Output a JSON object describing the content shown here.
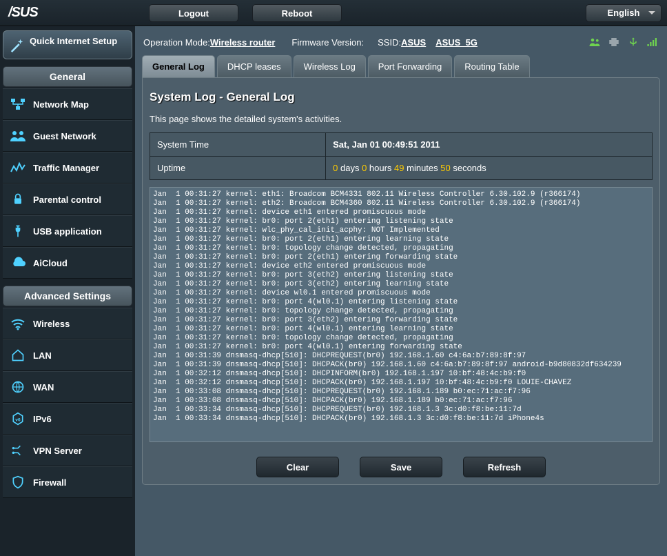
{
  "topbar": {
    "logo_text": "/SUS",
    "logout": "Logout",
    "reboot": "Reboot",
    "language": "English"
  },
  "qis": {
    "label": "Quick Internet Setup"
  },
  "sidebar": {
    "general_header": "General",
    "advanced_header": "Advanced Settings",
    "general": [
      {
        "label": "Network Map"
      },
      {
        "label": "Guest Network"
      },
      {
        "label": "Traffic Manager"
      },
      {
        "label": "Parental control"
      },
      {
        "label": "USB application"
      },
      {
        "label": "AiCloud"
      }
    ],
    "advanced": [
      {
        "label": "Wireless"
      },
      {
        "label": "LAN"
      },
      {
        "label": "WAN"
      },
      {
        "label": "IPv6"
      },
      {
        "label": "VPN Server"
      },
      {
        "label": "Firewall"
      }
    ]
  },
  "status": {
    "opmode_label": "Operation Mode: ",
    "opmode": "Wireless router",
    "fw_label": "Firmware Version:",
    "ssid_label": "SSID: ",
    "ssid1": "ASUS",
    "ssid2": "ASUS_5G"
  },
  "tabs": [
    {
      "label": "General Log",
      "active": true
    },
    {
      "label": "DHCP leases",
      "active": false
    },
    {
      "label": "Wireless Log",
      "active": false
    },
    {
      "label": "Port Forwarding",
      "active": false
    },
    {
      "label": "Routing Table",
      "active": false
    }
  ],
  "panel": {
    "title": "System Log - General Log",
    "desc": "This page shows the detailed system's activities.",
    "systime_label": "System Time",
    "systime_value": "Sat, Jan 01  00:49:51  2011",
    "uptime_label": "Uptime",
    "uptime_days": "0",
    "uptime_days_unit": " days ",
    "uptime_hours": "0",
    "uptime_hours_unit": " hours ",
    "uptime_min": "49",
    "uptime_min_unit": " minutes ",
    "uptime_sec": "50",
    "uptime_sec_unit": " seconds",
    "log": "Jan  1 00:31:27 kernel: eth1: Broadcom BCM4331 802.11 Wireless Controller 6.30.102.9 (r366174)\nJan  1 00:31:27 kernel: eth2: Broadcom BCM4360 802.11 Wireless Controller 6.30.102.9 (r366174)\nJan  1 00:31:27 kernel: device eth1 entered promiscuous mode\nJan  1 00:31:27 kernel: br0: port 2(eth1) entering listening state\nJan  1 00:31:27 kernel: wlc_phy_cal_init_acphy: NOT Implemented\nJan  1 00:31:27 kernel: br0: port 2(eth1) entering learning state\nJan  1 00:31:27 kernel: br0: topology change detected, propagating\nJan  1 00:31:27 kernel: br0: port 2(eth1) entering forwarding state\nJan  1 00:31:27 kernel: device eth2 entered promiscuous mode\nJan  1 00:31:27 kernel: br0: port 3(eth2) entering listening state\nJan  1 00:31:27 kernel: br0: port 3(eth2) entering learning state\nJan  1 00:31:27 kernel: device wl0.1 entered promiscuous mode\nJan  1 00:31:27 kernel: br0: port 4(wl0.1) entering listening state\nJan  1 00:31:27 kernel: br0: topology change detected, propagating\nJan  1 00:31:27 kernel: br0: port 3(eth2) entering forwarding state\nJan  1 00:31:27 kernel: br0: port 4(wl0.1) entering learning state\nJan  1 00:31:27 kernel: br0: topology change detected, propagating\nJan  1 00:31:27 kernel: br0: port 4(wl0.1) entering forwarding state\nJan  1 00:31:39 dnsmasq-dhcp[510]: DHCPREQUEST(br0) 192.168.1.60 c4:6a:b7:89:8f:97\nJan  1 00:31:39 dnsmasq-dhcp[510]: DHCPACK(br0) 192.168.1.60 c4:6a:b7:89:8f:97 android-b9d80832df634239\nJan  1 00:32:12 dnsmasq-dhcp[510]: DHCPINFORM(br0) 192.168.1.197 10:bf:48:4c:b9:f0\nJan  1 00:32:12 dnsmasq-dhcp[510]: DHCPACK(br0) 192.168.1.197 10:bf:48:4c:b9:f0 LOUIE-CHAVEZ\nJan  1 00:33:08 dnsmasq-dhcp[510]: DHCPREQUEST(br0) 192.168.1.189 b0:ec:71:ac:f7:96\nJan  1 00:33:08 dnsmasq-dhcp[510]: DHCPACK(br0) 192.168.1.189 b0:ec:71:ac:f7:96\nJan  1 00:33:34 dnsmasq-dhcp[510]: DHCPREQUEST(br0) 192.168.1.3 3c:d0:f8:be:11:7d\nJan  1 00:33:34 dnsmasq-dhcp[510]: DHCPACK(br0) 192.168.1.3 3c:d0:f8:be:11:7d iPhone4s",
    "btn_clear": "Clear",
    "btn_save": "Save",
    "btn_refresh": "Refresh"
  }
}
